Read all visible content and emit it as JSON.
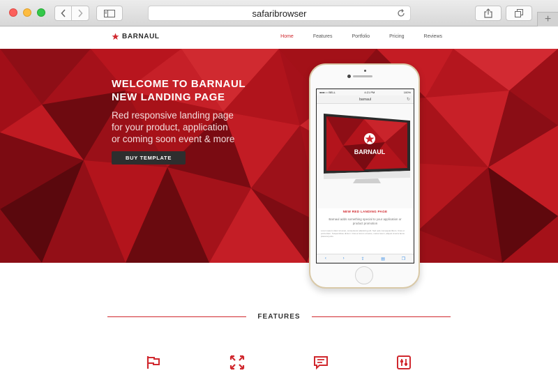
{
  "browser": {
    "address": "safaribrowser",
    "new_tab": "+"
  },
  "site": {
    "brand": "BARNAUL",
    "nav": [
      {
        "label": "Home",
        "active": true
      },
      {
        "label": "Features",
        "active": false
      },
      {
        "label": "Portfolio",
        "active": false
      },
      {
        "label": "Pricing",
        "active": false
      },
      {
        "label": "Reviews",
        "active": false
      }
    ]
  },
  "hero": {
    "title_line1": "WELCOME TO BARNAUL",
    "title_line2": "NEW LANDING PAGE",
    "sub_line1": "Red responsive landing page",
    "sub_line2": "for your product, application",
    "sub_line3": "or coming soon event & more",
    "button": "BUY TEMPLATE"
  },
  "phone": {
    "carrier": "●●●○○ BELL",
    "time": "4:21 PM",
    "battery": "100%",
    "url": "barnaul",
    "monitor_brand": "BARNAUL",
    "title": "NEW RED LANDING PAGE",
    "desc": "Barnaul adds something special to your application or product promotion",
    "body": "Lorem ipsum dolor sit amet, consectetur adipiscing elit. Sed quis consequat libero. Cras et porta diam. Suspendisse dictum. Cras et lorem ut lacus, metus lorem, aliquet viverra lacus placerat justo."
  },
  "features": {
    "heading": "FEATURES",
    "icons": [
      "flag-icon",
      "expand-icon",
      "chat-icon",
      "sliders-icon"
    ]
  },
  "colors": {
    "accent": "#d0282e",
    "hero_base": "#a5111a",
    "button_dark": "#2e2e2e"
  }
}
